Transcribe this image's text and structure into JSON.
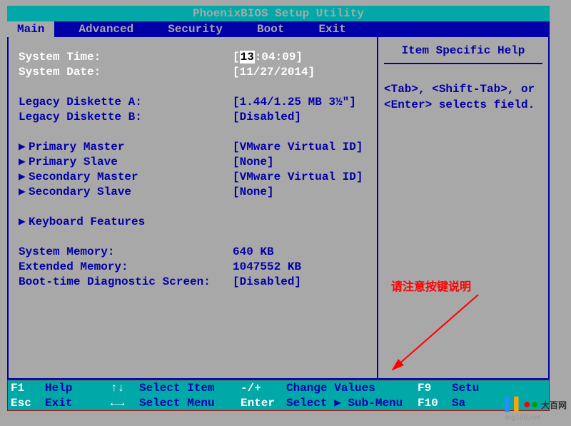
{
  "title": "PhoenixBIOS Setup Utility",
  "menu": {
    "items": [
      {
        "label": "Main",
        "active": true
      },
      {
        "label": "Advanced",
        "active": false
      },
      {
        "label": "Security",
        "active": false
      },
      {
        "label": "Boot",
        "active": false
      },
      {
        "label": "Exit",
        "active": false
      }
    ]
  },
  "fields": {
    "system_time": {
      "label": "System Time:",
      "hh": "13",
      "rest": ":04:09"
    },
    "system_date": {
      "label": "System Date:",
      "value": "[11/27/2014]"
    },
    "legacy_a": {
      "label": "Legacy Diskette A:",
      "value": "[1.44/1.25 MB  3½\"]"
    },
    "legacy_b": {
      "label": "Legacy Diskette B:",
      "value": "[Disabled]"
    },
    "pri_master": {
      "label": "Primary Master",
      "value": "[VMware Virtual ID]"
    },
    "pri_slave": {
      "label": "Primary Slave",
      "value": "[None]"
    },
    "sec_master": {
      "label": "Secondary Master",
      "value": "[VMware Virtual ID]"
    },
    "sec_slave": {
      "label": "Secondary Slave",
      "value": "[None]"
    },
    "kbd": {
      "label": "Keyboard Features"
    },
    "sys_mem": {
      "label": "System Memory:",
      "value": "640 KB"
    },
    "ext_mem": {
      "label": "Extended Memory:",
      "value": "1047552 KB"
    },
    "boot_diag": {
      "label": "Boot-time Diagnostic Screen:",
      "value": "[Disabled]"
    }
  },
  "help": {
    "title": "Item Specific Help",
    "line1": "<Tab>, <Shift-Tab>, or",
    "line2": "<Enter> selects field."
  },
  "footer": {
    "f1_key": "F1",
    "f1_action": "Help",
    "updown": "↑↓",
    "select_item": "Select Item",
    "pm": "-/+",
    "change_values": "Change Values",
    "f9_key": "F9",
    "f9_action": "Setu",
    "esc_key": "Esc",
    "esc_action": "Exit",
    "lr": "←→",
    "select_menu": "Select Menu",
    "enter_key": "Enter",
    "select_sub": "Select ▶ Sub-Menu",
    "f10_key": "F10",
    "f10_action": "Sa"
  },
  "annotation": "请注意按键说明",
  "watermark": {
    "brand": "大百网",
    "url": "big100.net"
  }
}
